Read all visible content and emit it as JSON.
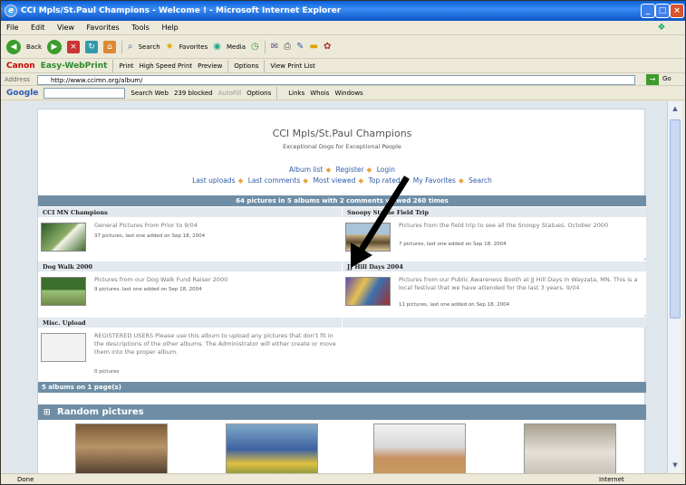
{
  "window": {
    "title": "CCI Mpls/St.Paul Champions - Welcome ! - Microsoft Internet Explorer"
  },
  "menu": [
    "File",
    "Edit",
    "View",
    "Favorites",
    "Tools",
    "Help"
  ],
  "toolbar": {
    "back": "Back",
    "search": "Search",
    "favorites": "Favorites",
    "media": "Media"
  },
  "canon": {
    "brand": "Canon",
    "product": "Easy-WebPrint",
    "print": "Print",
    "high_speed": "High Speed Print",
    "preview": "Preview",
    "options": "Options",
    "view_list": "View Print List"
  },
  "address": {
    "label": "Address",
    "url": "http://www.ccimn.org/album/",
    "go": "Go"
  },
  "google": {
    "brand": "Google",
    "search_web": "Search Web",
    "blocked": "239 blocked",
    "autofill": "AutoFill",
    "options": "Options",
    "links": "Links",
    "whois": "Whois",
    "windows": "Windows"
  },
  "site": {
    "title": "CCI Mpls/St.Paul Champions",
    "subtitle": "Exceptional Dogs for Exceptional People",
    "nav1": [
      "Album list",
      "Register",
      "Login"
    ],
    "nav2": [
      "Last uploads",
      "Last comments",
      "Most viewed",
      "Top rated",
      "My Favorites",
      "Search"
    ],
    "stats": "64 pictures in 5 albums with 2 comments viewed 260 times",
    "albums": [
      {
        "name": "CCI MN Champions",
        "desc": "General Pictures From Prior to 9/04",
        "meta": "37 pictures, last one added on Sep 18, 2004"
      },
      {
        "name": "Snoopy Statue Field Trip",
        "desc": "Pictures from the field trip to see all the Snoopy Statues. October 2000",
        "meta": "7 pictures, last one added on Sep 18, 2004"
      },
      {
        "name": "Dog Walk 2000",
        "desc": "Pictures from our Dog Walk Fund Raiser 2000",
        "meta": "9 pictures, last one added on Sep 18, 2004"
      },
      {
        "name": "JJ Hill Days 2004",
        "desc": "Pictures from our Public Awareness Booth at JJ Hill Days in Wayzata, MN. This is a local festival that we have attended for the last 3 years. 9/04",
        "meta": "11 pictures, last one added on Sep 18, 2004"
      },
      {
        "name": "Misc. Upload",
        "desc": "REGISTERED USERS Please use this album to upload any pictures that don't fit in the descriptions of the other albums. The Administrator will either create or move them into the proper album.",
        "meta": "0 pictures"
      }
    ],
    "albums_footer": "5 albums on 1 page(s)",
    "random_header": "Random pictures"
  },
  "status": {
    "left": "Done",
    "zone": "Internet"
  },
  "colors": {
    "accent": "#6f8ea6",
    "link": "#2f5aa8",
    "titlebar": "#0a5fd8"
  }
}
